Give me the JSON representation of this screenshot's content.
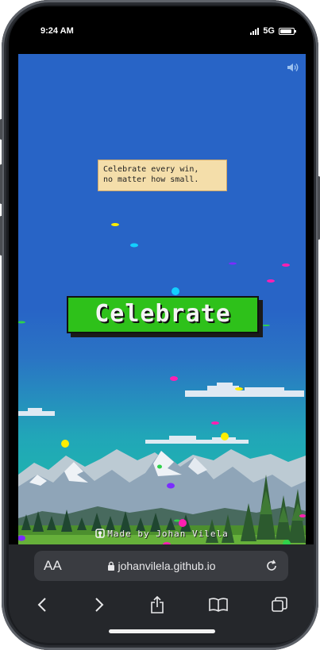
{
  "status_bar": {
    "time": "9:24 AM",
    "network": "5G",
    "battery_level": 0.9,
    "icons": [
      "signal-bars-icon",
      "battery-icon"
    ]
  },
  "page": {
    "quote": "Celebrate every win,\nno matter how small.",
    "celebrate_label": "Celebrate",
    "credit": "Made by Johan Vilela",
    "icons": [
      "speaker-icon",
      "github-icon"
    ],
    "colors": {
      "sky": "#2864c6",
      "button": "#2ec11a",
      "quote_bg": "#f4deaa"
    },
    "confetti_colors": [
      "#ffee00",
      "#12d0ff",
      "#ff1fb1",
      "#7b2cff",
      "#2fd14a"
    ]
  },
  "browser": {
    "text_size_label": "AA",
    "url": "johanvilela.github.io",
    "icons": [
      "lock-icon",
      "reload-icon",
      "back-icon",
      "forward-icon",
      "share-icon",
      "bookmarks-icon",
      "tabs-icon"
    ]
  }
}
